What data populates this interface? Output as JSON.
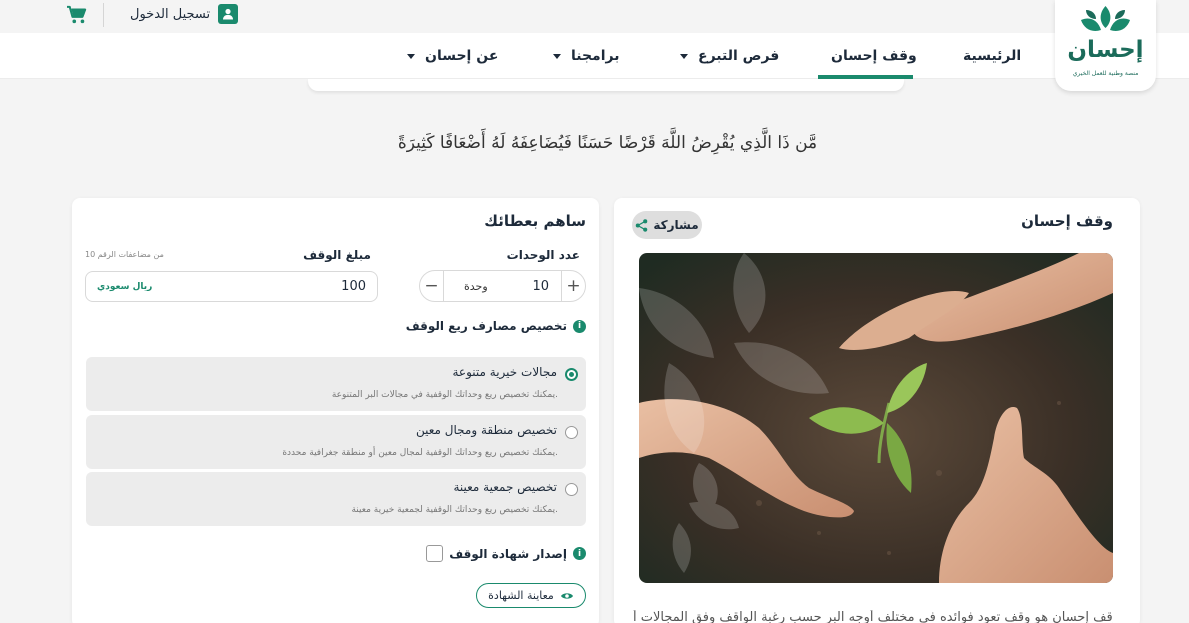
{
  "topbar": {
    "login_label": "تسجيل الدخول",
    "icons": {
      "cart": "cart-icon",
      "user": "user-icon"
    }
  },
  "logo": {
    "word": "إحسان",
    "tagline": "منصة وطنية للعمل الخيري"
  },
  "nav": {
    "items": [
      {
        "label": "الرئيسية",
        "has_caret": false
      },
      {
        "label": "وقف إحسان",
        "has_caret": false,
        "active": true
      },
      {
        "label": "فرص التبرع",
        "has_caret": true
      },
      {
        "label": "برامجنا",
        "has_caret": true
      },
      {
        "label": "عن إحسان",
        "has_caret": true
      }
    ]
  },
  "verse": "مَّن ذَا الَّذِي يُقْرِضُ اللَّهَ قَرْضًا حَسَنًا فَيُضَاعِفَهُ لَهُ أَضْعَافًا كَثِيرَةً",
  "waqf_card": {
    "title": "وقف إحسان",
    "share_label": "مشاركة",
    "description": "وقف إحسان هو وقف تعود فوائده في مختلف أوجه البر حسب رغبة الواقف وفق المجالات أ"
  },
  "contribute": {
    "title": "ساهم بعطائك",
    "units_label": "عدد الوحدات",
    "units_value": "10",
    "units_unit": "وحدة",
    "amount_label": "مبلغ الوقف",
    "amount_hint": "من مضاعفات الرقم 10",
    "amount_value": "100",
    "currency": "ريال سعودي",
    "allocation_title": "تخصيص مصارف ريع الوقف",
    "options": [
      {
        "title": "مجالات خيرية متنوعة",
        "subtitle": "يمكنك تخصيص ريع وحداتك الوقفية في مجالات البر المتنوعة.",
        "selected": true
      },
      {
        "title": "تخصيص منطقة ومجال معين",
        "subtitle": "يمكنك تخصيص ريع وحداتك الوقفية لمجال معين أو منطقة جغرافية محددة.",
        "selected": false
      },
      {
        "title": "تخصيص جمعية معينة",
        "subtitle": "يمكنك تخصيص ريع وحداتك الوقفية لجمعية خيرية معينة.",
        "selected": false
      }
    ],
    "certificate_label": "إصدار شهادة الوقف",
    "certificate_checked": false,
    "preview_label": "معاينة الشهادة"
  },
  "colors": {
    "brand": "#1a8a6d",
    "brand_dark": "#1b6b5a",
    "text": "#1d2a3a"
  }
}
